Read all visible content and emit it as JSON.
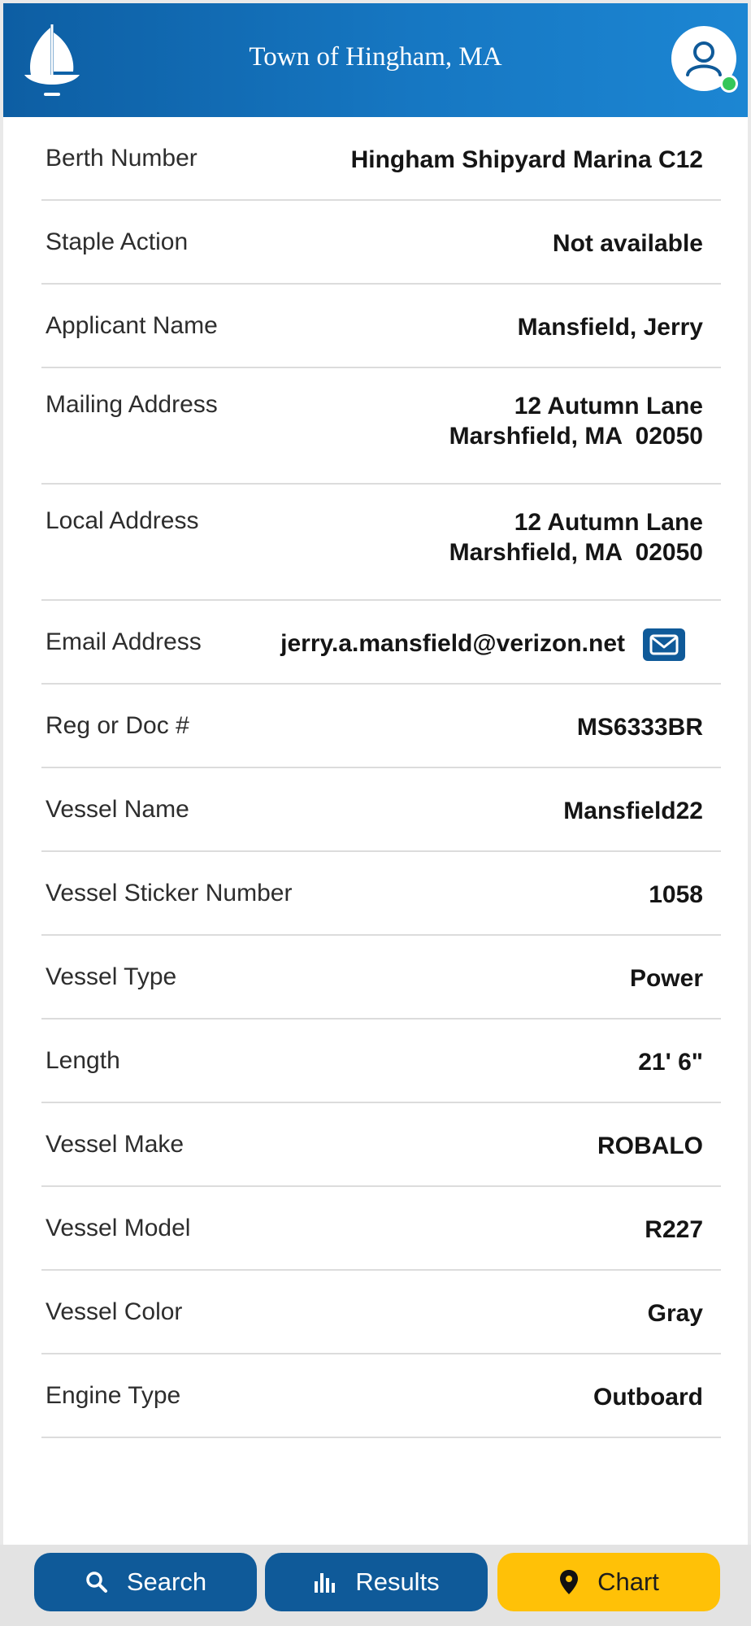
{
  "app": {
    "title": "Town of Hingham, MA",
    "logo_icon": "sailboat-logo",
    "profile_icon": "user-avatar-icon",
    "online_status": "online",
    "accent_color": "#0f5a99",
    "highlight_color": "#ffc107"
  },
  "details": {
    "berth_number": {
      "label": "Berth Number",
      "value": "Hingham Shipyard Marina C12"
    },
    "staple_action": {
      "label": "Staple Action",
      "value": "Not available"
    },
    "applicant_name": {
      "label": "Applicant Name",
      "value": "Mansfield, Jerry"
    },
    "mailing_address": {
      "label": "Mailing Address",
      "line1": "12 Autumn Lane",
      "line2": "Marshfield, MA  02050"
    },
    "local_address": {
      "label": "Local Address",
      "line1": "12 Autumn Lane",
      "line2": "Marshfield, MA  02050"
    },
    "email_address": {
      "label": "Email Address",
      "value": "jerry.a.mansfield@verizon.net",
      "action_icon": "mail-icon"
    },
    "reg_or_doc": {
      "label": "Reg or Doc #",
      "value": "MS6333BR"
    },
    "vessel_name": {
      "label": "Vessel Name",
      "value": "Mansfield22"
    },
    "vessel_sticker_number": {
      "label": "Vessel Sticker Number",
      "value": "1058"
    },
    "vessel_type": {
      "label": "Vessel Type",
      "value": "Power"
    },
    "length": {
      "label": "Length",
      "value": "21' 6\""
    },
    "vessel_make": {
      "label": "Vessel Make",
      "value": "ROBALO"
    },
    "vessel_model": {
      "label": "Vessel Model",
      "value": "R227"
    },
    "vessel_color": {
      "label": "Vessel Color",
      "value": "Gray"
    },
    "engine_type": {
      "label": "Engine Type",
      "value": "Outboard"
    }
  },
  "bottom_nav": {
    "search": {
      "label": "Search",
      "icon": "search-icon"
    },
    "results": {
      "label": "Results",
      "icon": "bar-chart-icon"
    },
    "chart": {
      "label": "Chart",
      "icon": "map-pin-icon"
    }
  }
}
